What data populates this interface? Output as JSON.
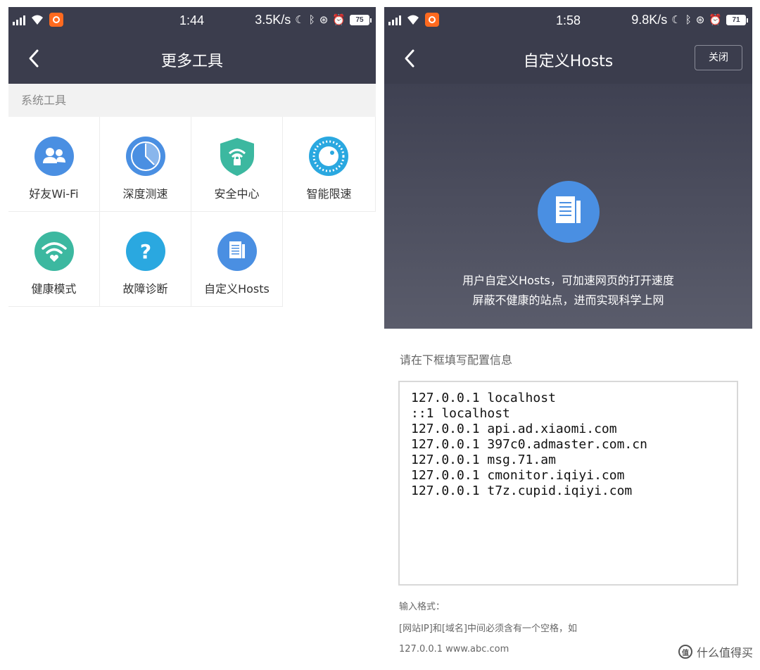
{
  "left_screen": {
    "status": {
      "time": "1:44",
      "speed": "3.5K/s",
      "battery": "75"
    },
    "title": "更多工具",
    "section": "系统工具",
    "tools": [
      {
        "label": "好友Wi-Fi",
        "icon": "friends-icon",
        "color": "#4a8fe2"
      },
      {
        "label": "深度测速",
        "icon": "speed-dial-icon",
        "color": "#4a8fe2"
      },
      {
        "label": "安全中心",
        "icon": "shield-lock-icon",
        "color": "#3cb8a0"
      },
      {
        "label": "智能限速",
        "icon": "speed-limit-icon",
        "color": "#2aa8e0"
      },
      {
        "label": "健康模式",
        "icon": "wifi-heart-icon",
        "color": "#3cb8a0"
      },
      {
        "label": "故障诊断",
        "icon": "question-icon",
        "color": "#2aa8e0"
      },
      {
        "label": "自定义Hosts",
        "icon": "document-icon",
        "color": "#4a8fe2"
      }
    ]
  },
  "right_screen": {
    "status": {
      "time": "1:58",
      "speed": "9.8K/s",
      "battery": "71"
    },
    "title": "自定义Hosts",
    "close_label": "关闭",
    "description": [
      "用户自定义Hosts，可加速网页的打开速度",
      "屏蔽不健康的站点，进而实现科学上网"
    ],
    "prompt": "请在下框填写配置信息",
    "hosts_lines": [
      "127.0.0.1 localhost",
      "::1 localhost",
      "127.0.0.1 api.ad.xiaomi.com",
      "127.0.0.1 397c0.admaster.com.cn",
      "127.0.0.1 msg.71.am",
      "127.0.0.1 cmonitor.iqiyi.com",
      "127.0.0.1 t7z.cupid.iqiyi.com"
    ],
    "format_title": "输入格式：",
    "format_rule": "[网站IP]和[域名]中间必须含有一个空格，如",
    "format_example": "127.0.0.1 www.abc.com"
  },
  "watermark": "什么值得买",
  "colors": {
    "header": "#3b3d4d",
    "accent_blue": "#4a8fe2",
    "accent_teal": "#3cb8a0"
  }
}
